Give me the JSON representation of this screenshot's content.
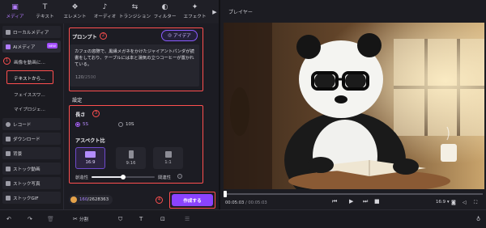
{
  "toolbar": {
    "tabs": [
      {
        "label": "メディア",
        "icon": "media-icon",
        "glyph": "▣"
      },
      {
        "label": "テキスト",
        "icon": "text-icon",
        "glyph": "T"
      },
      {
        "label": "エレメント",
        "icon": "element-icon",
        "glyph": "❖"
      },
      {
        "label": "オーディオ",
        "icon": "audio-icon",
        "glyph": "♪"
      },
      {
        "label": "トランジション",
        "icon": "transition-icon",
        "glyph": "⇆"
      },
      {
        "label": "フィルター",
        "icon": "filter-icon",
        "glyph": "◐"
      },
      {
        "label": "エフェクト",
        "icon": "effect-icon",
        "glyph": "✦"
      }
    ],
    "more": "▶"
  },
  "sidebar": {
    "local_media": "ローカルメディア",
    "ai_media": "AIメディア",
    "ai_badge": "NEW",
    "image_to_video": "画像を動画に...",
    "text_to_video": "テキストから...",
    "face_swap": "フェイススワ...",
    "my_project": "マイプロジェ...",
    "record": "レコード",
    "download": "ダウンロード",
    "background": "背景",
    "stock_video": "ストック動画",
    "stock_photo": "ストック写真",
    "stock_gif": "ストックGIF"
  },
  "annotations": {
    "n1": "1",
    "n2": "2",
    "n3": "3",
    "n4": "4"
  },
  "panel": {
    "prompt_title": "プロンプト",
    "idea_button": "アイデア",
    "prompt_text": "カフェの窓際で、黒縁メガネをかけたジャイアントパンダが読書をしており、テーブルには本と湯気の立つコーヒーが置かれている。",
    "char_count": "120",
    "char_max": "/2500",
    "settings_title": "設定",
    "length_label": "長さ",
    "length_options": [
      "5S",
      "10S"
    ],
    "aspect_label": "アスペクト比",
    "aspect_options": [
      "16:9",
      "9:16",
      "1:1"
    ],
    "slider_left": "創造性",
    "slider_right": "関連性",
    "slider_value": 0.5,
    "credits_used": "160",
    "credits_total": "/2628363",
    "generate_button": "作成する"
  },
  "player": {
    "title": "プレイヤー",
    "time_current": "00:05:03",
    "time_total": "/ 00:05:03",
    "aspect": "16:9",
    "progress": 0.0
  },
  "bottom": {
    "split_label": "分割"
  },
  "colors": {
    "accent": "#8a43ff",
    "annotation": "#ff4f4f"
  }
}
